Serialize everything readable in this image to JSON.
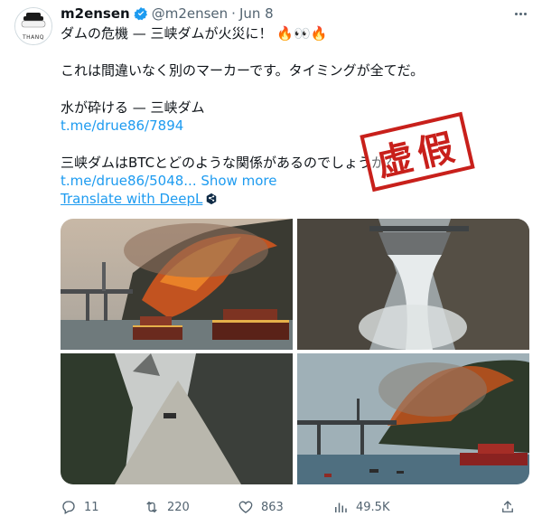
{
  "tweet": {
    "display_name": "m2ensen",
    "handle": "@m2ensen",
    "date": "Jun 8",
    "avatar_text": "THANQ",
    "lines": {
      "l1": "ダムの危機 — 三峡ダムが火災に！ 🔥👀🔥",
      "l2": "これは間違いなく別のマーカーです。タイミングが全てだ。",
      "l3": "水が砕ける — 三峡ダム",
      "link1": "t.me/drue86/7894",
      "l4": "三峡ダムはBTCとどのような関係があるのでしょうか？",
      "link2": "t.me/drue86/5048...",
      "show_more": "Show more",
      "translate": "Translate with DeepL"
    },
    "stamp": "虚假",
    "stats": {
      "replies": "11",
      "retweets": "220",
      "likes": "863",
      "views": "49.5K"
    }
  },
  "colors": {
    "accent": "#1d9bf0",
    "text": "#0f1419",
    "muted": "#536471",
    "stamp": "#c8201b"
  },
  "icons": [
    "verified-badge-icon",
    "more-icon",
    "deepl-icon",
    "reply-icon",
    "retweet-icon",
    "like-icon",
    "views-icon",
    "share-icon"
  ]
}
